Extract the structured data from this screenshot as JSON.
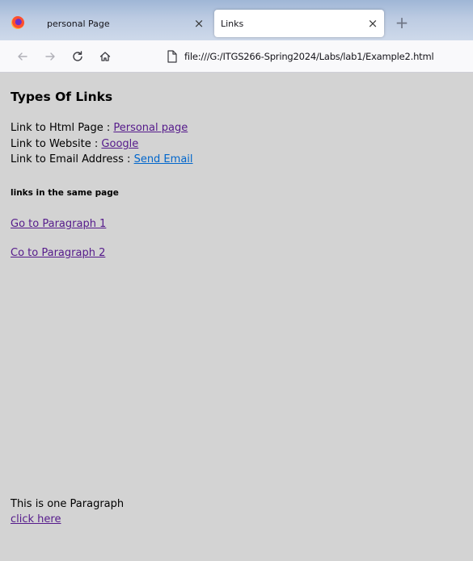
{
  "browser": {
    "tabs": [
      {
        "title": "personal Page",
        "close": "×",
        "active": false
      },
      {
        "title": "Links",
        "close": "×",
        "active": true
      }
    ],
    "new_tab": "+",
    "url": "file:///G:/ITGS266-Spring2024/Labs/lab1/Example2.html",
    "icons": {
      "back": "arrow-left-icon",
      "forward": "arrow-right-icon",
      "reload": "reload-icon",
      "home": "home-icon",
      "page": "page-icon"
    }
  },
  "page": {
    "heading": "Types Of Links",
    "links": [
      {
        "label": "Link to Html Page :",
        "link_text": "Personal page",
        "visited": true
      },
      {
        "label": "Link to Website :",
        "link_text": "Google",
        "visited": true
      },
      {
        "label": "Link to Email Address :",
        "link_text": "Send Email",
        "visited": false
      }
    ],
    "subheading": "links in the same page",
    "anchor1": "Go to Paragraph 1",
    "anchor2": "Co to Paragraph 2",
    "paragraph": "This is one Paragraph",
    "click_here": "click here"
  },
  "colors": {
    "visited_link": "#551a8b",
    "unvisited_link": "#0066cc",
    "page_background": "#d3d3d3"
  }
}
